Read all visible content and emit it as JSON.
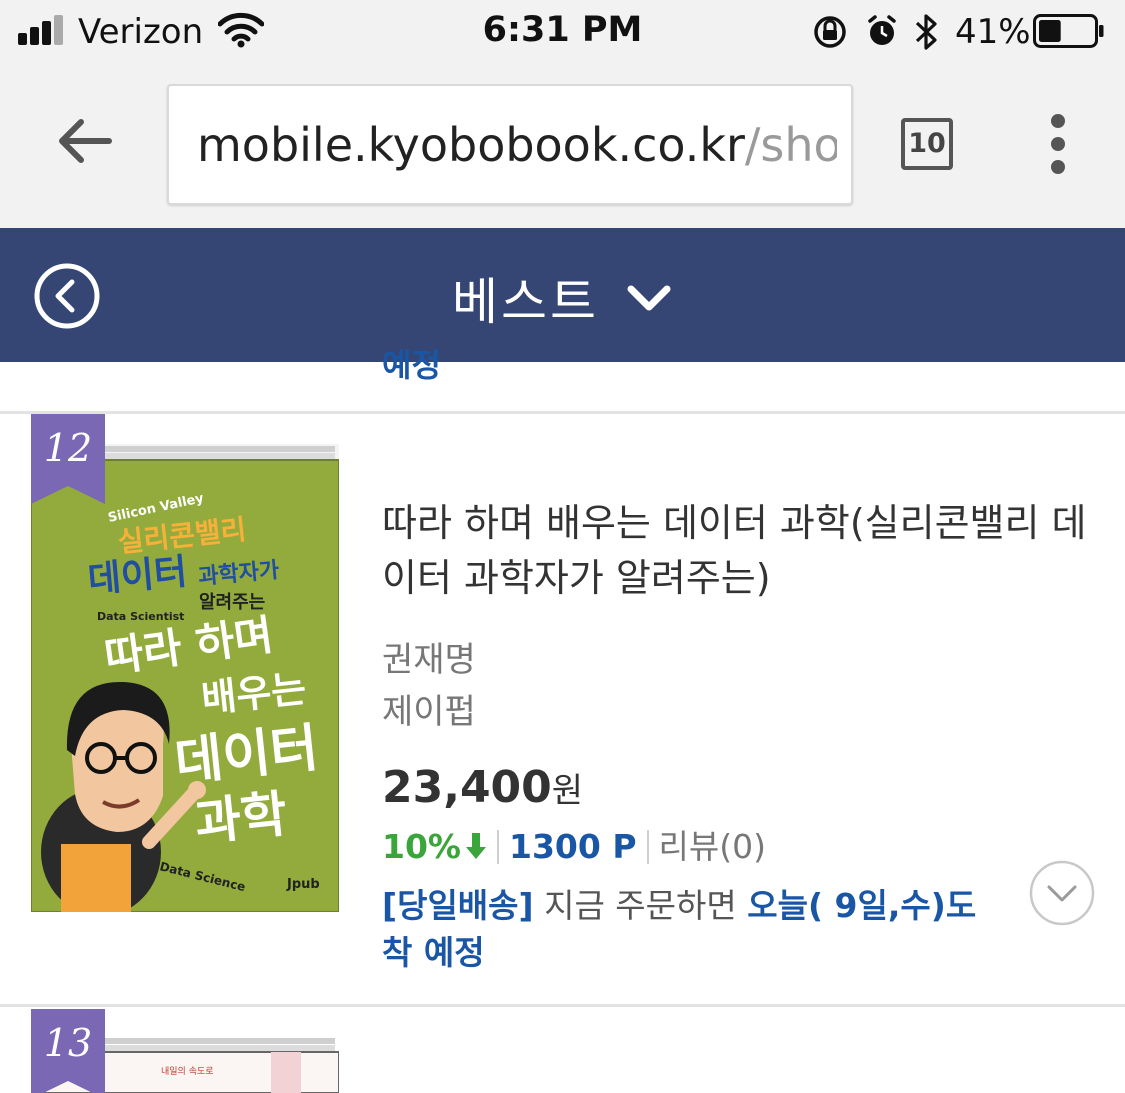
{
  "status_bar": {
    "carrier": "Verizon",
    "time": "6:31 PM",
    "battery_percent": "41%",
    "battery_level": 0.41,
    "icons": [
      "signal-icon",
      "wifi-icon",
      "orientation-lock-icon",
      "alarm-icon",
      "bluetooth-icon",
      "battery-icon"
    ]
  },
  "browser": {
    "url_host": "mobile.kyobobook.co.kr",
    "url_path": "/sho…",
    "tab_count": "10"
  },
  "nav": {
    "title": "베스트"
  },
  "previous_item_tail": "예정",
  "books": [
    {
      "rank": "12",
      "title": "따라 하며 배우는 데이터 과학(실리콘밸리 데이터 과학자가 알려주는)",
      "author": "권재명",
      "publisher": "제이펍",
      "price": "23,400",
      "price_unit": "원",
      "discount": "10%",
      "points": "1300 P",
      "review": "리뷰(0)",
      "delivery_tag": "[당일배송]",
      "delivery_text": " 지금 주문하면 ",
      "delivery_arrive": "오늘( 9일,수)도착 예정"
    },
    {
      "rank": "13"
    }
  ],
  "colors": {
    "nav_bg": "#354674",
    "rank_ribbon": "#7b68b5",
    "link_blue": "#1a56a6",
    "discount_green": "#3aa53a",
    "chrome_bg": "#f2f2f2"
  }
}
